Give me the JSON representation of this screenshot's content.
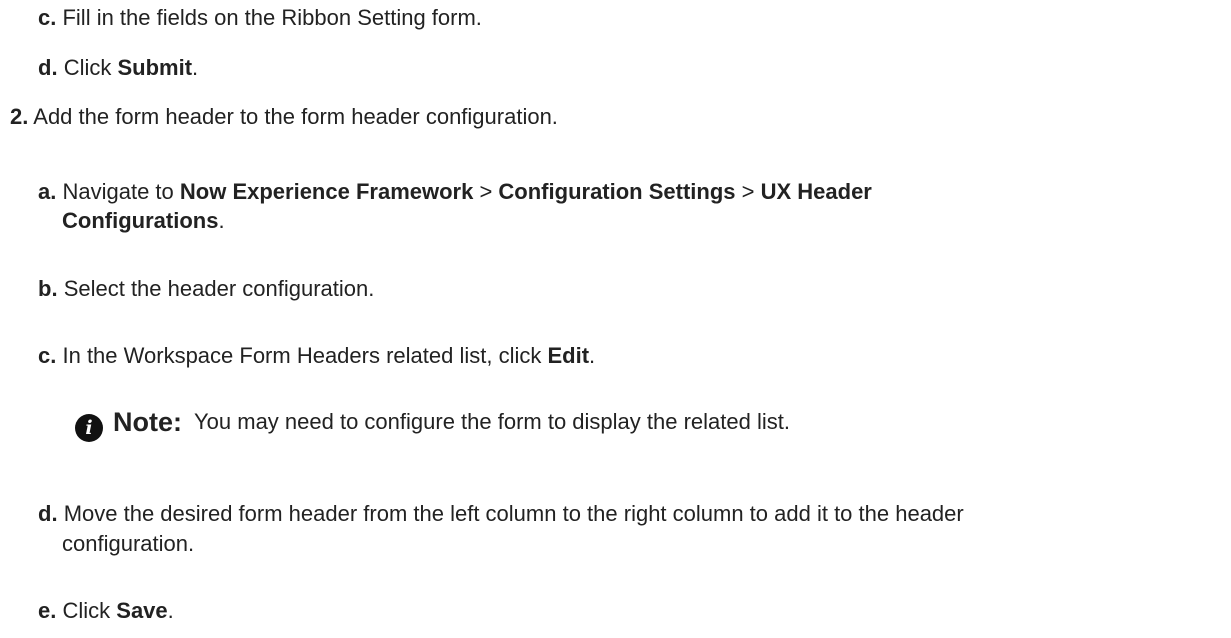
{
  "steps": {
    "c1": {
      "marker": "c.",
      "text": "Fill in the fields on the Ribbon Setting form."
    },
    "d1": {
      "marker": "d.",
      "pre": "Click ",
      "bold": "Submit",
      "post": "."
    },
    "s2": {
      "marker": "2.",
      "text": "Add the form header to the form header configuration."
    },
    "a2": {
      "marker": "a.",
      "pre": "Navigate to ",
      "b1": "Now Experience Framework",
      "sep1": " > ",
      "b2": "Configuration Settings",
      "sep2": " > ",
      "b3a": "UX Header",
      "b3b": "Configurations",
      "post": "."
    },
    "b2": {
      "marker": "b.",
      "text": "Select the header configuration."
    },
    "c2": {
      "marker": "c.",
      "pre": "In the Workspace Form Headers related list, click ",
      "bold": "Edit",
      "post": "."
    },
    "note": {
      "icon": "info-icon",
      "glyph": "i",
      "label": "Note:",
      "text": "You may need to configure the form to display the related list."
    },
    "d2": {
      "marker": "d.",
      "line1": "Move the desired form header from the left column to the right column to add it to the header",
      "line2": "configuration."
    },
    "e2": {
      "marker": "e.",
      "pre": "Click ",
      "bold": "Save",
      "post": "."
    }
  }
}
